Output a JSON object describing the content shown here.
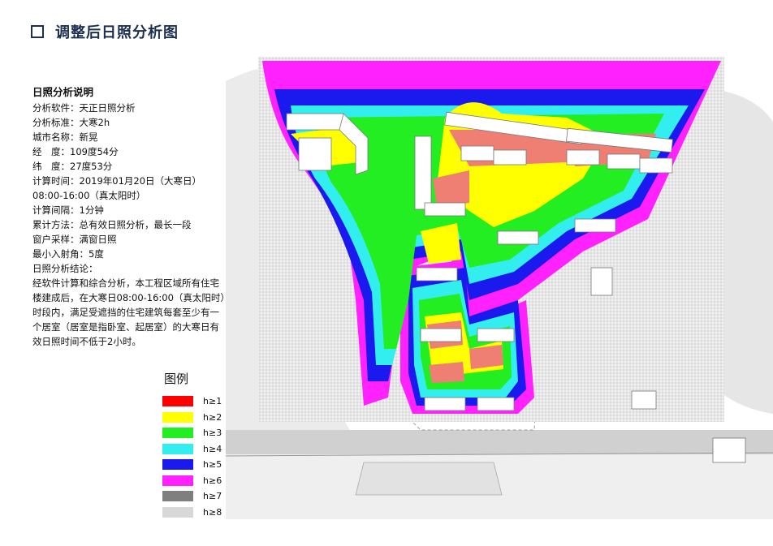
{
  "header": {
    "title": "调整后日照分析图"
  },
  "notes": {
    "heading": "日照分析说明",
    "lines": [
      "分析软件：天正日照分析",
      "分析标准：大寒2h",
      "城市名称：新晃",
      "经　度：109度54分",
      "纬　度：27度53分",
      "计算时间：2019年01月20日（大寒日）",
      "08:00-16:00（真太阳时）",
      "计算间隔：1分钟",
      "累计方法：总有效日照分析，最长一段",
      "窗户采样：满窗日照",
      "最小入射角：5度",
      "日照分析结论："
    ],
    "conclusion": "经软件计算和综合分析，本工程区域所有住宅楼建成后，在大寒日08:00-16:00（真太阳时）时段内，满足受遮挡的住宅建筑每套至少有一个居室（居室是指卧室、起居室）的大寒日有效日照时间不低于2小时。"
  },
  "legend": {
    "title": "图例",
    "items": [
      {
        "label": "h≥1",
        "color": "#ff0000"
      },
      {
        "label": "h≥2",
        "color": "#ffff00"
      },
      {
        "label": "h≥3",
        "color": "#22ee22"
      },
      {
        "label": "h≥4",
        "color": "#33eeee"
      },
      {
        "label": "h≥5",
        "color": "#1a1aee"
      },
      {
        "label": "h≥6",
        "color": "#ff22ff"
      },
      {
        "label": "h≥7",
        "color": "#7f7f7f"
      },
      {
        "label": "h≥8",
        "color": "#d8d8d8"
      }
    ]
  }
}
